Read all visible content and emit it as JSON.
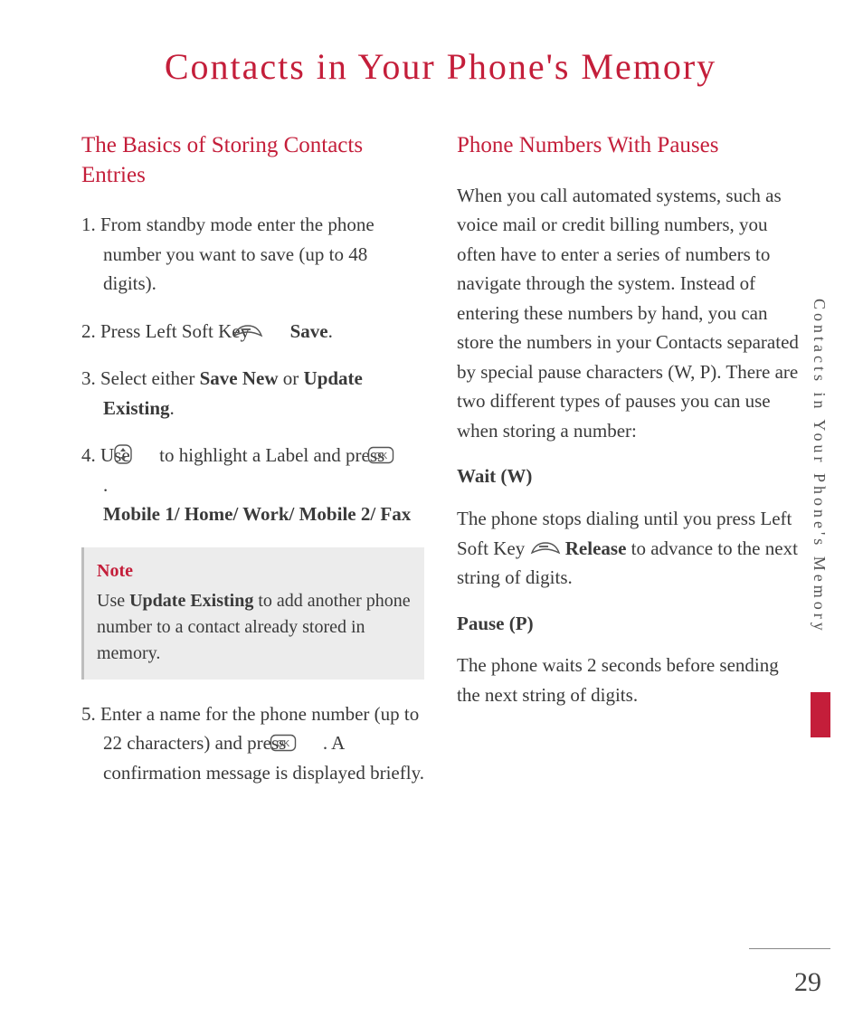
{
  "page_title": "Contacts in Your Phone's Memory",
  "side_tab": "Contacts in Your Phone's Memory",
  "page_number": "29",
  "left": {
    "heading": "The Basics of Storing Contacts Entries",
    "step1": "1. From standby mode enter the phone number you want to save (up to 48 digits).",
    "step2_a": "2. Press Left Soft Key ",
    "step2_b": " Save",
    "step2_c": ".",
    "step3_a": "3. Select either ",
    "step3_b": "Save New",
    "step3_c": " or ",
    "step3_d": "Update Existing",
    "step3_e": ".",
    "step4_a": "4. Use  ",
    "step4_b": "  to highlight a Label and press  ",
    "step4_c": " .",
    "step4_labels": "Mobile 1/ Home/ Work/ Mobile 2/ Fax",
    "note_label": "Note",
    "note_a": "Use ",
    "note_b": "Update Existing",
    "note_c": " to add another phone number to a contact already stored in memory.",
    "step5_a": "5. Enter a name for the phone number (up to 22 characters) and press  ",
    "step5_b": " . A confirmation message is displayed briefly."
  },
  "right": {
    "heading": "Phone Numbers With Pauses",
    "intro": "When you call automated systems, such as voice mail or credit billing numbers, you often have to enter a series of numbers to navigate through the system. Instead of entering these numbers by hand, you can store the numbers in your Contacts separated by special pause characters (W, P). There are two different types of pauses you can use when storing a number:",
    "wait_h": "Wait (W)",
    "wait_a": "The phone stops dialing until you press Left Soft Key ",
    "wait_b": "Release",
    "wait_c": " to advance to the next string of digits.",
    "pause_h": "Pause (P)",
    "pause_body": "The phone waits 2 seconds before sending the next string of digits."
  }
}
